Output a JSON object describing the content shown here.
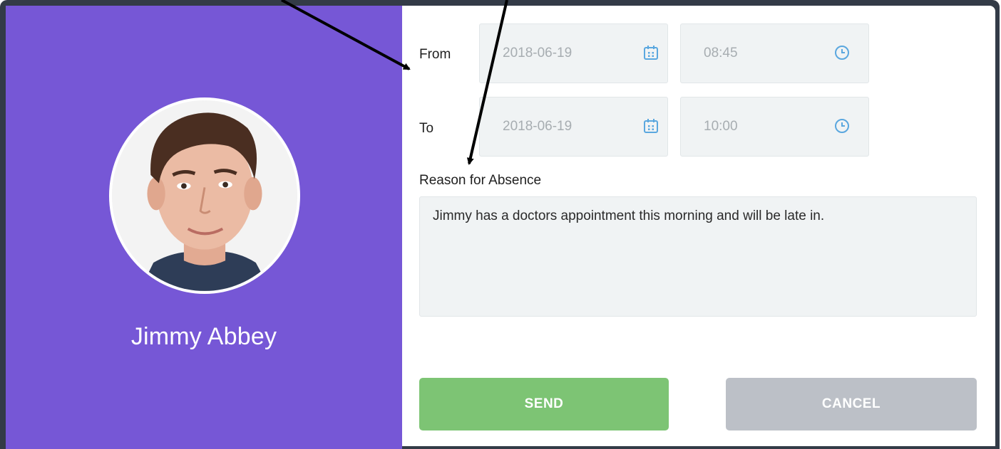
{
  "student": {
    "name": "Jimmy Abbey"
  },
  "form": {
    "from_label": "From",
    "to_label": "To",
    "from_date": "2018-06-19",
    "from_time": "08:45",
    "to_date": "2018-06-19",
    "to_time": "10:00",
    "reason_label": "Reason for Absence",
    "reason_text": "Jimmy has a doctors appointment this morning and will be late in."
  },
  "actions": {
    "send_label": "SEND",
    "cancel_label": "CANCEL"
  },
  "icons": {
    "date": "calendar-icon",
    "time": "clock-icon"
  },
  "colors": {
    "panel": "#7657d6",
    "send": "#7dc474",
    "cancel": "#bcc0c7",
    "field_bg": "#f0f3f4",
    "icon_blue": "#5aa7df"
  }
}
